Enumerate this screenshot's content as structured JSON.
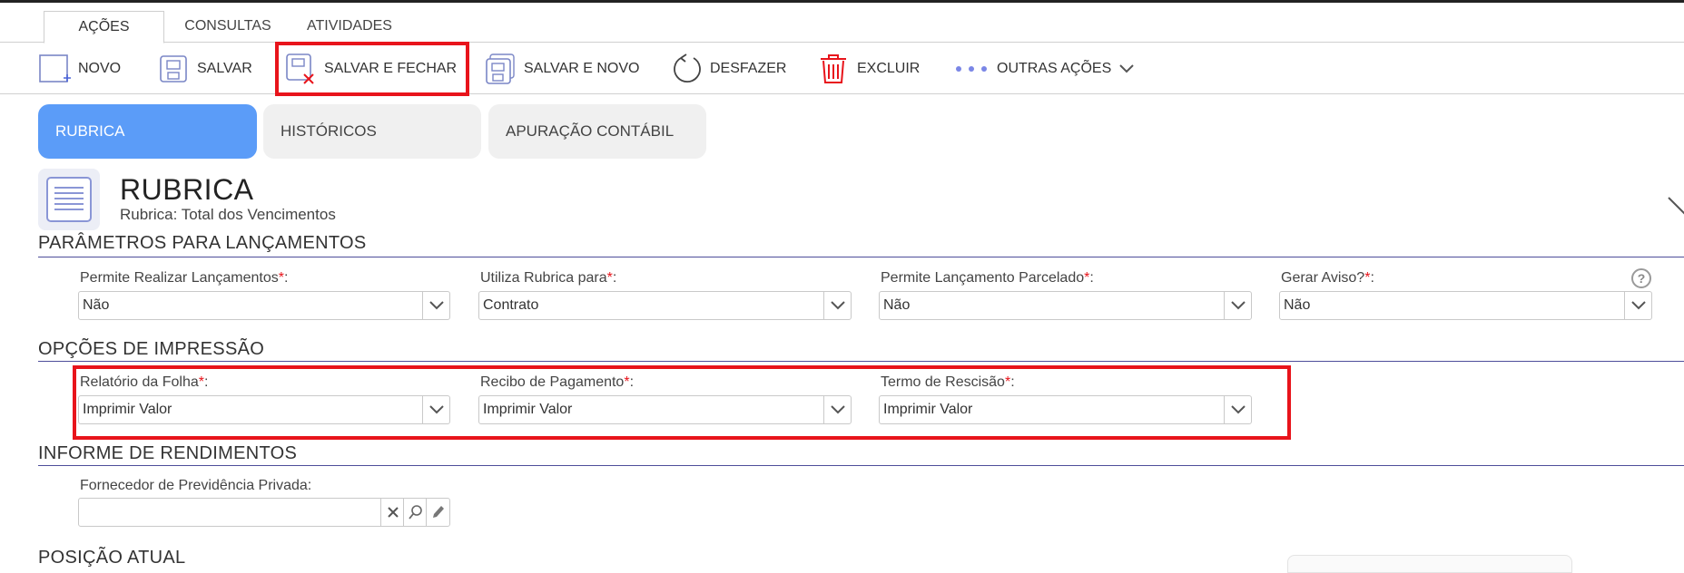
{
  "top_tabs": [
    {
      "label": "AÇÕES",
      "active": true
    },
    {
      "label": "CONSULTAS",
      "active": false
    },
    {
      "label": "ATIVIDADES",
      "active": false
    }
  ],
  "toolbar": {
    "novo": "NOVO",
    "salvar": "SALVAR",
    "salvar_fechar": "SALVAR E FECHAR",
    "salvar_novo": "SALVAR E NOVO",
    "desfazer": "DESFAZER",
    "excluir": "EXCLUIR",
    "outras_acoes": "OUTRAS AÇÕES"
  },
  "section_tabs": [
    {
      "label": "RUBRICA",
      "active": true
    },
    {
      "label": "HISTÓRICOS",
      "active": false
    },
    {
      "label": "APURAÇÃO CONTÁBIL",
      "active": false
    }
  ],
  "header": {
    "title": "RUBRICA",
    "subtitle": "Rubrica: Total dos Vencimentos"
  },
  "sections": {
    "parametros": {
      "title": "PARÂMETROS PARA LANÇAMENTOS",
      "fields": [
        {
          "label": "Permite Realizar Lançamentos",
          "value": "Não"
        },
        {
          "label": "Utiliza Rubrica para",
          "value": "Contrato"
        },
        {
          "label": "Permite Lançamento Parcelado",
          "value": "Não"
        },
        {
          "label": "Gerar Aviso?",
          "value": "Não"
        }
      ]
    },
    "impressao": {
      "title": "OPÇÕES DE IMPRESSÃO",
      "fields": [
        {
          "label": "Relatório da Folha",
          "value": "Imprimir Valor"
        },
        {
          "label": "Recibo de Pagamento",
          "value": "Imprimir Valor"
        },
        {
          "label": "Termo de Rescisão",
          "value": "Imprimir Valor"
        }
      ]
    },
    "informe": {
      "title": "INFORME DE RENDIMENTOS",
      "fornecedor_label": "Fornecedor de Previdência Privada:",
      "fornecedor_value": ""
    },
    "posicao": {
      "title": "POSIÇÃO ATUAL"
    }
  },
  "required_marker": "*",
  "label_suffix": ":",
  "help_symbol": "?",
  "colors": {
    "accent": "#5b9cf8",
    "highlight": "#e8141b",
    "section_line": "#4d4d9a",
    "delete_icon": "#e8141b"
  }
}
